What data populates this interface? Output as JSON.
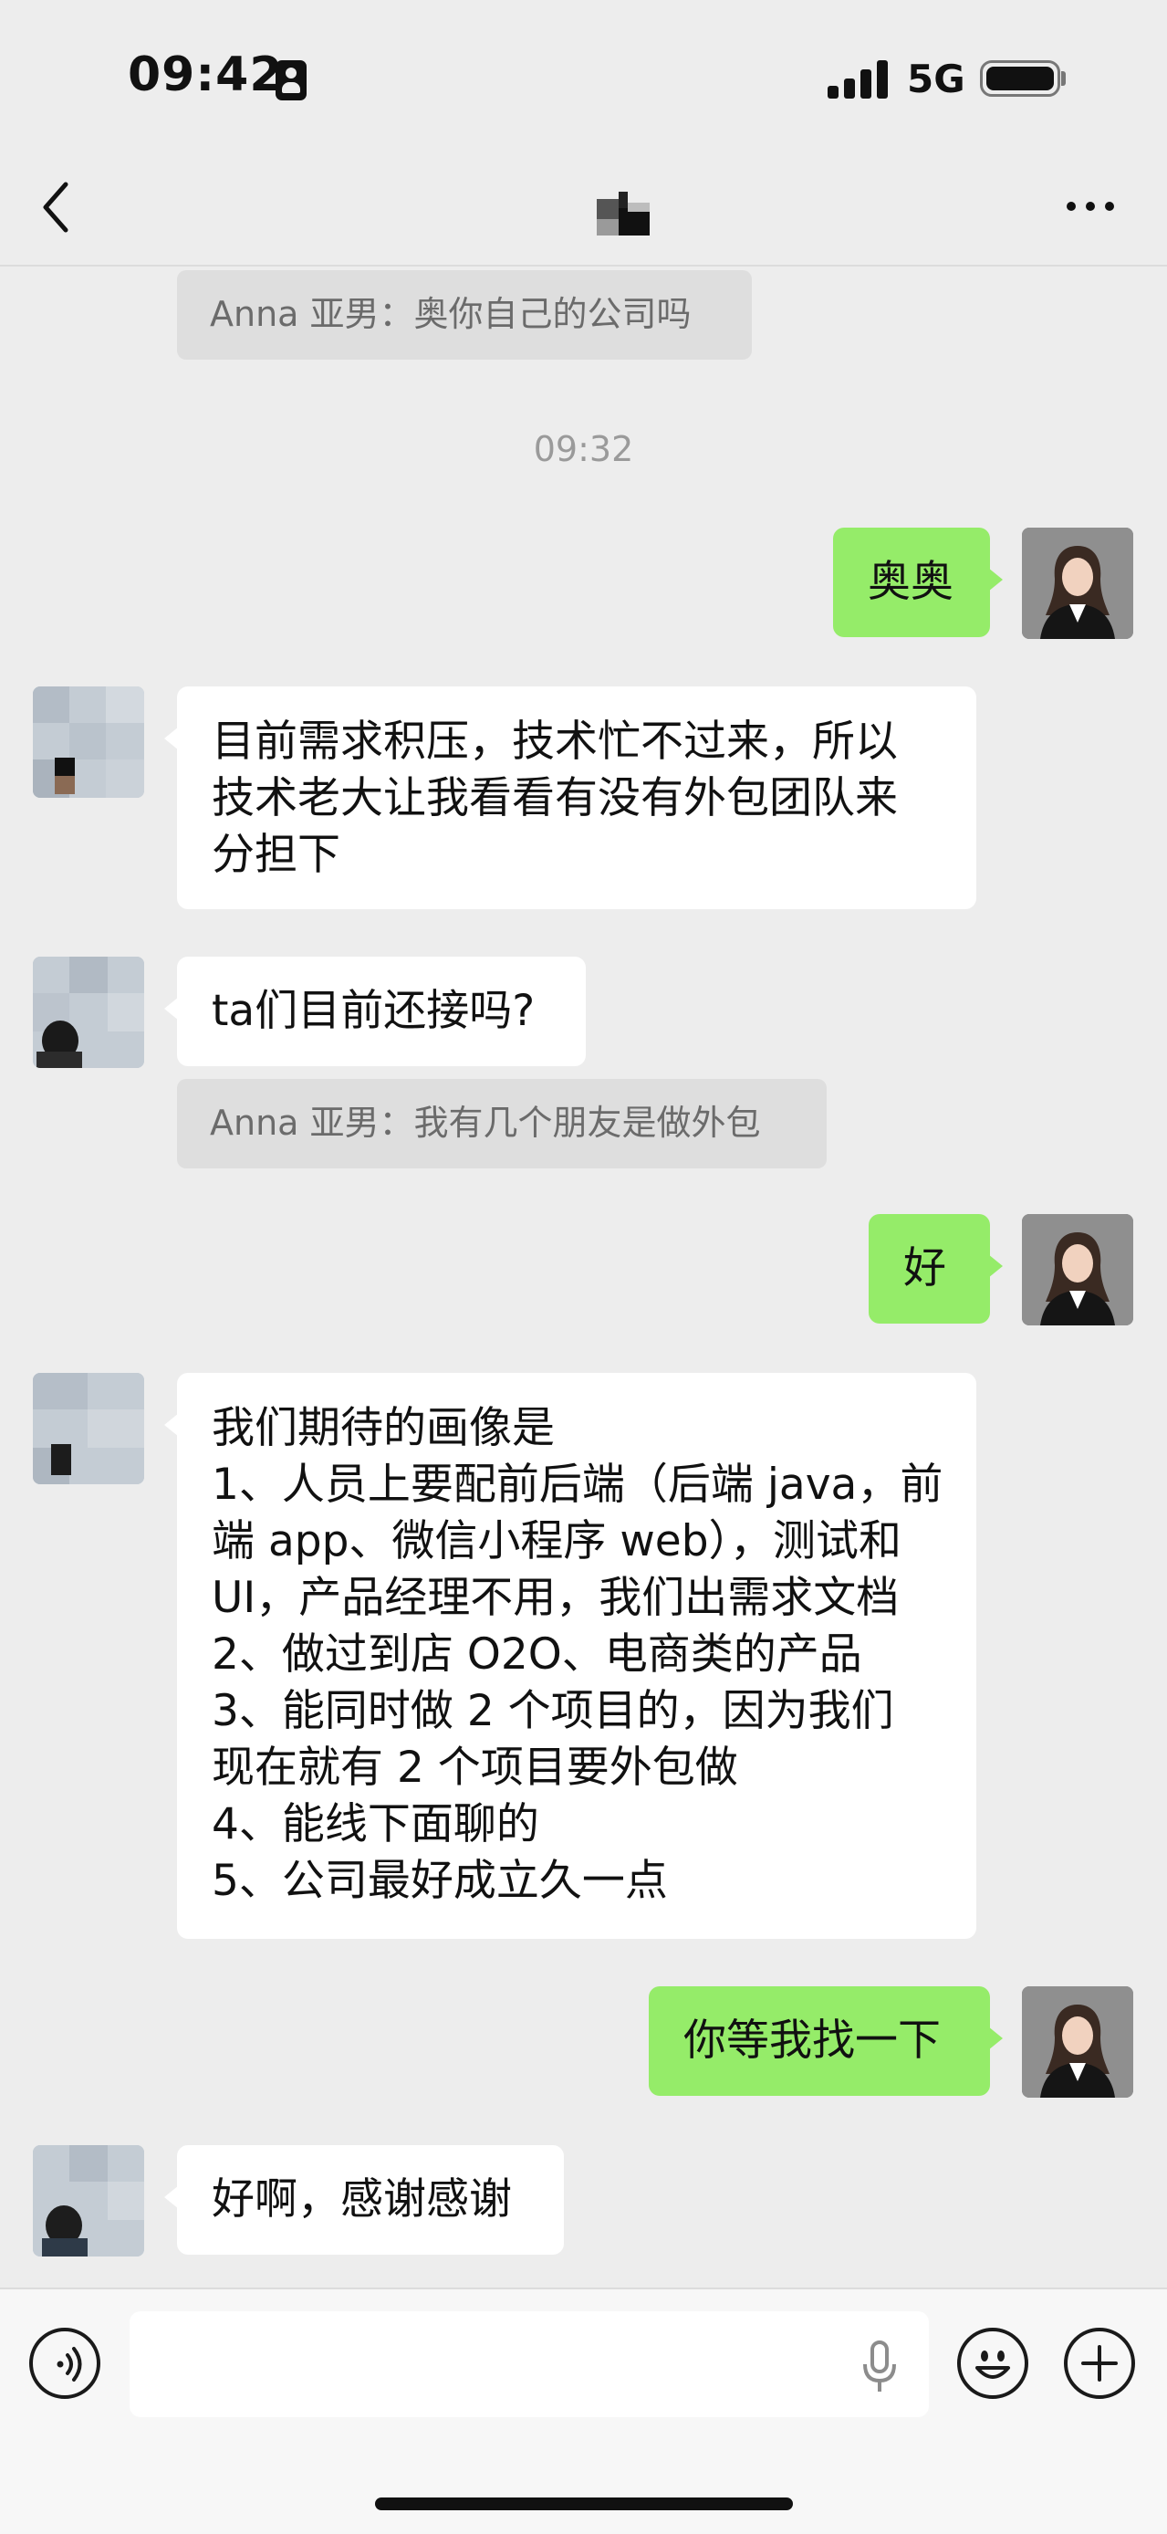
{
  "status_bar": {
    "time": "09:42",
    "network": "5G"
  },
  "nav": {
    "title_icon": "redacted-contact-name",
    "back_icon": "back-chevron-icon",
    "more_icon": "more-dots-icon"
  },
  "quotes": [
    {
      "text": "Anna 亚男：奥你自己的公司吗"
    },
    {
      "text": "Anna 亚男：我有几个朋友是做外包"
    }
  ],
  "timestamp": "09:32",
  "messages": [
    {
      "sender": "me",
      "lines": [
        "奥奥"
      ]
    },
    {
      "sender": "other",
      "lines": [
        "目前需求积压，技术忙不过来，所以",
        "技术老大让我看看有没有外包团队来",
        "分担下"
      ]
    },
    {
      "sender": "other",
      "lines": [
        "ta们目前还接吗?"
      ]
    },
    {
      "sender": "me",
      "lines": [
        "好"
      ]
    },
    {
      "sender": "other",
      "lines": [
        "我们期待的画像是",
        "1、人员上要配前后端（后端 java，前",
        "端 app、微信小程序 web），测试和",
        "UI，产品经理不用，我们出需求文档",
        "2、做过到店 O2O、电商类的产品",
        "3、能同时做 2 个项目的，因为我们",
        "现在就有 2 个项目要外包做",
        "4、能线下面聊的",
        "5、公司最好成立久一点"
      ]
    },
    {
      "sender": "me",
      "lines": [
        "你等我找一下"
      ]
    },
    {
      "sender": "other",
      "lines": [
        "好啊，感谢感谢"
      ]
    }
  ],
  "input_bar": {
    "voice_icon": "voice-mode-icon",
    "mic_icon": "microphone-icon",
    "emoji_icon": "emoji-icon",
    "plus_icon": "plus-icon",
    "text_value": ""
  },
  "colors": {
    "background": "#ededed",
    "my_bubble": "#95ec69",
    "other_bubble": "#ffffff",
    "quote_bg": "#dedede"
  }
}
